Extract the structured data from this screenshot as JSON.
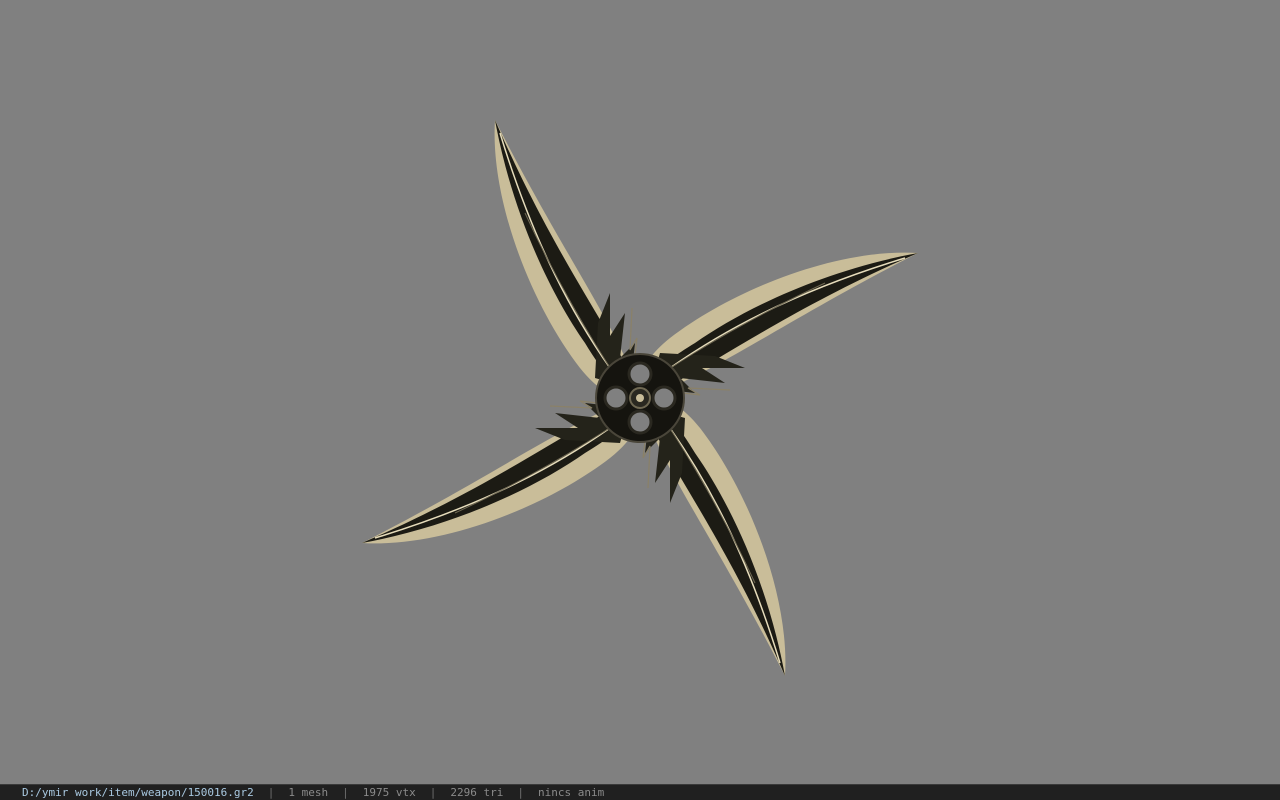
{
  "viewer": {
    "background_color": "#808080",
    "model_object": "weapon-shuriken",
    "blade_dark_color": "#1a1913",
    "blade_edge_color": "#c9bd99"
  },
  "status_bar": {
    "file_path": "D:/ymir work/item/weapon/150016.gr2",
    "mesh_count": "1 mesh",
    "vertex_count": "1975 vtx",
    "triangle_count": "2296 tri",
    "anim_status": "nincs anim"
  }
}
